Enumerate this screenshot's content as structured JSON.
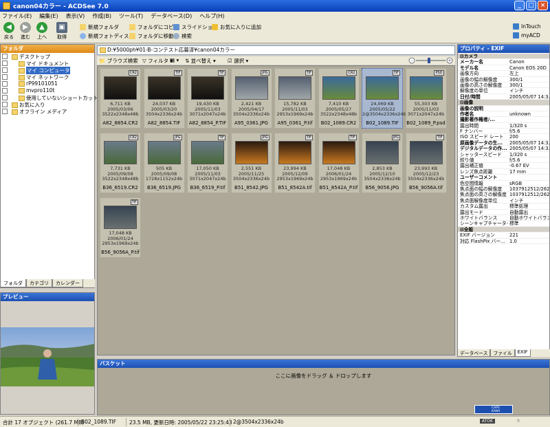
{
  "window": {
    "title": "canon04カラー - ACDSee 7.0"
  },
  "menu": [
    "ファイル(E)",
    "編集(E)",
    "表示(V)",
    "作成(B)",
    "ツール(T)",
    "データベース(D)",
    "ヘルプ(H)"
  ],
  "toolbar": {
    "back": "戻る",
    "forward": "進む",
    "up": "上へ",
    "acquire": "取得",
    "new_folder": "新規フォルダ",
    "new_photo_disc": "新規フォトディスク",
    "copy_to_folder": "フォルダにコピー",
    "move_to_folder": "フォルダに移動",
    "slideshow": "スライドショー",
    "search": "検索",
    "add_favorite": "お気に入りに追加",
    "intouch": "InTouch",
    "myacd": "myACD"
  },
  "folders": {
    "header": "フォルダ",
    "items": [
      {
        "label": "デスクトップ",
        "indent": 0
      },
      {
        "label": "マイ ドキュメント",
        "indent": 1
      },
      {
        "label": "マイ コンピュータ",
        "indent": 1,
        "selected": true
      },
      {
        "label": "マイ ネットワーク",
        "indent": 1
      },
      {
        "label": "rP99101051",
        "indent": 1
      },
      {
        "label": "mvpro110t",
        "indent": 1
      },
      {
        "label": "使用していないショートカット",
        "indent": 1
      },
      {
        "label": "お気に入り",
        "indent": 0
      },
      {
        "label": "オフライン メディア",
        "indent": 0
      }
    ],
    "tabs": [
      "フォルダ",
      "カテゴリ",
      "カレンダー"
    ]
  },
  "preview": {
    "header": "プレビュー"
  },
  "address": "D:¥5000ph¥01-B-コンテスト応募済¥canon04カラー",
  "browse_tools": {
    "browse_search": "ブラウズ検索",
    "filter": "フィルタ",
    "sort": "並べ替え",
    "select": "選択"
  },
  "thumbs": [
    {
      "name": "A82_8854.CR2",
      "size": "6,711 KB",
      "date": "2005/03/06",
      "dims": "3522x2348x48b",
      "badge": "CR2"
    },
    {
      "name": "A82_8854.TIF",
      "size": "24,037 KB",
      "date": "2005/03/20",
      "dims": "3504x2336x24b",
      "badge": "TIF"
    },
    {
      "name": "A82_8854_P.TIF",
      "size": "19,430 KB",
      "date": "2005/11/03",
      "dims": "3071x2047x24b",
      "badge": "TIF"
    },
    {
      "name": "A95_0361.JPG",
      "size": "2,421 KB",
      "date": "2005/04/17",
      "dims": "3504x2336x24b",
      "badge": "JPG"
    },
    {
      "name": "A95_0361_P.tif",
      "size": "15,782 KB",
      "date": "2005/11/03",
      "dims": "2953x1969x24b",
      "badge": "TIF"
    },
    {
      "name": "B02_1089.CR2",
      "size": "7,410 KB",
      "date": "2005/05/27",
      "dims": "3522x2348x48b",
      "badge": "CR2"
    },
    {
      "name": "B02_1089.TIF",
      "size": "24,069 KB",
      "date": "2005/05/22",
      "dims": "2@3504x2336x24b",
      "badge": "TIF",
      "selected": true
    },
    {
      "name": "B02_1089_P.psd",
      "size": "55,303 KB",
      "date": "2005/11/03",
      "dims": "3071x2047x24b",
      "badge": "PSD"
    },
    {
      "name": "B36_6519.CR2",
      "size": "7,731 KB",
      "date": "2005/09/08",
      "dims": "3522x2348x48b",
      "badge": "CR2"
    },
    {
      "name": "B36_6519.JPG",
      "size": "505 KB",
      "date": "2005/09/08",
      "dims": "1728x1152x24b",
      "badge": "JPG"
    },
    {
      "name": "B36_6519_P.tif",
      "size": "17,050 KB",
      "date": "2005/11/03",
      "dims": "3071x2047x24b",
      "badge": "TIF"
    },
    {
      "name": "B51_8542.JPG",
      "size": "2,551 KB",
      "date": "2005/11/25",
      "dims": "3504x2336x24b",
      "badge": "JPG"
    },
    {
      "name": "B51_8542A.tif",
      "size": "23,994 KB",
      "date": "2005/12/09",
      "dims": "2953x1969x24b",
      "badge": "TIF"
    },
    {
      "name": "B51_8542A_P.tif",
      "size": "17,048 KB",
      "date": "2006/01/24",
      "dims": "2953x1969x24b",
      "badge": "TIF"
    },
    {
      "name": "B56_9056.JPG",
      "size": "2,853 KB",
      "date": "2005/12/10",
      "dims": "3504x2336x24b",
      "badge": "JPG"
    },
    {
      "name": "B56_9056A.tif",
      "size": "23,993 KB",
      "date": "2005/12/23",
      "dims": "3504x2336x24b",
      "badge": "TIF"
    },
    {
      "name": "B56_9056A_P.tif",
      "size": "17,048 KB",
      "date": "2006/01/24",
      "dims": "2953x1969x24b",
      "badge": "TIF"
    }
  ],
  "props": {
    "header": "プロパティ - EXIF",
    "rows": [
      {
        "s": "カメラ"
      },
      {
        "k": "メーカー名",
        "v": "Canon",
        "b": true
      },
      {
        "k": "モデル名",
        "v": "Canon EOS 20D",
        "b": true
      },
      {
        "k": "画像方向",
        "v": "左上"
      },
      {
        "k": "画像の幅の解像度",
        "v": "300/1"
      },
      {
        "k": "画像の高さの解像度",
        "v": "300/1"
      },
      {
        "k": "解像度の単位",
        "v": "インチ"
      },
      {
        "k": "日付/時間",
        "v": "2005/05/07 14:3...",
        "b": true
      },
      {
        "s": "画像"
      },
      {
        "k": "画像の説明",
        "v": "",
        "b": true
      },
      {
        "k": "作者名",
        "v": "unknown",
        "b": true
      },
      {
        "k": "撮影著作権者/...",
        "v": "",
        "b": true
      },
      {
        "k": "露出時間",
        "v": "1/320 s"
      },
      {
        "k": "F ナンバー",
        "v": "f/5.6"
      },
      {
        "k": "ISO スピード レート",
        "v": "200"
      },
      {
        "k": "原画像データの生...",
        "v": "2005/05/07 14:3...",
        "b": true
      },
      {
        "k": "デジタルデータの作...",
        "v": "2005/05/07 14:3...",
        "b": true
      },
      {
        "k": "シャッタースピード",
        "v": "1/320 s"
      },
      {
        "k": "絞り値",
        "v": "f/5.6"
      },
      {
        "k": "露出補正値",
        "v": "-0.67 EV"
      },
      {
        "k": "レンズ焦点距離",
        "v": "17 mm"
      },
      {
        "k": "ユーザーコメント",
        "v": "",
        "b": true
      },
      {
        "k": "色空間情報",
        "v": "sRGB"
      },
      {
        "k": "焦点面の幅の解像度",
        "v": "1037912512/262..."
      },
      {
        "k": "焦点面の高さの解像度",
        "v": "1037912512/262..."
      },
      {
        "k": "焦点面解像度単位",
        "v": "インチ"
      },
      {
        "k": "カスタム露出",
        "v": "標準処理"
      },
      {
        "k": "露出モード",
        "v": "自動露出"
      },
      {
        "k": "ホワイトバランス",
        "v": "自動ホワイトバランス"
      },
      {
        "k": "シーンキャプチャータイ...",
        "v": "標準"
      },
      {
        "s": "全般"
      },
      {
        "k": "EXIF バージョン",
        "v": "221"
      },
      {
        "k": "対応 FlashPix バー...",
        "v": "1.0"
      }
    ],
    "tabs": [
      "データベース",
      "ファイル",
      "EXIF"
    ]
  },
  "basket": {
    "header": "バスケット",
    "hint": "ここに画像をドラッグ ＆ ドロップします"
  },
  "ime": {
    "label": "CAPS KANA",
    "atok": "ATOK",
    "r": "R"
  },
  "status": {
    "total": "合計 17 オブジェクト (261.7 MB)",
    "file": "B02_1089.TIF",
    "info": "23.5 MB, 更新日時: 2005/05/22 23:25:43",
    "dims": "2@3504x2336x24b"
  }
}
